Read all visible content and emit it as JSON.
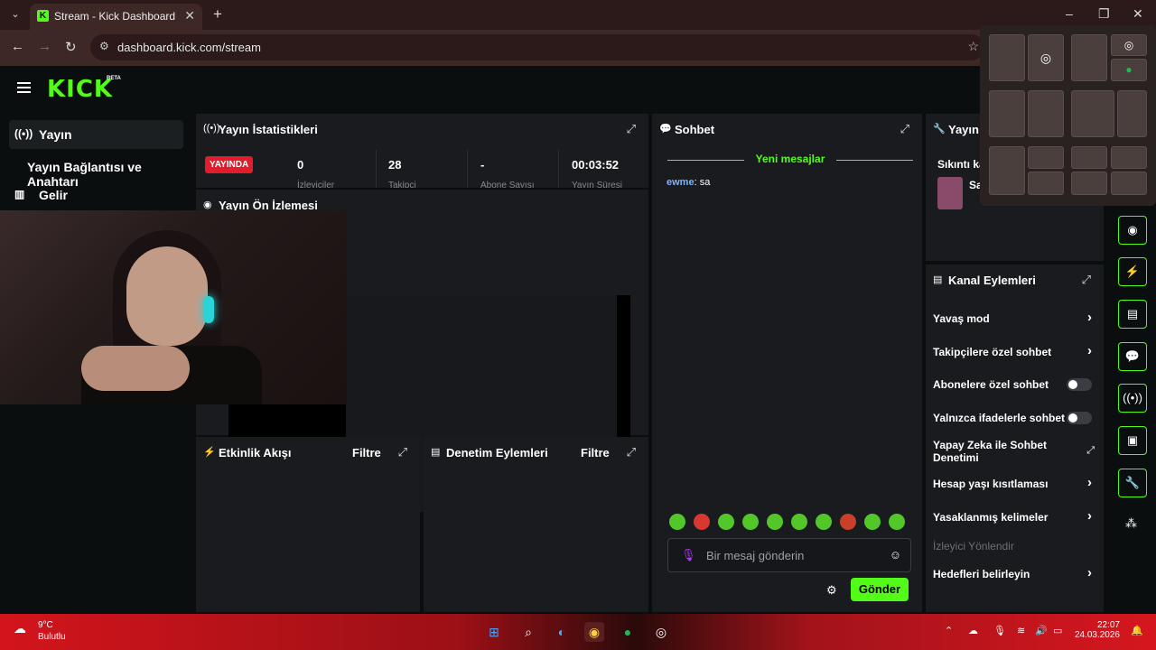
{
  "browser": {
    "tab_title": "Stream - Kick Dashboard",
    "url": "dashboard.kick.com/stream"
  },
  "header": {
    "logo": "KICK",
    "beta": "BETA"
  },
  "sidebar": {
    "items": [
      {
        "label": "Yayın",
        "icon": "broadcast-icon"
      },
      {
        "label": "Yayın Bağlantısı ve Anahtarı"
      },
      {
        "label": "Gelir",
        "icon": "chart-icon"
      }
    ]
  },
  "stats": {
    "title": "Yayın İstatistikleri",
    "live_badge": "YAYINDA",
    "values": [
      "0",
      "28",
      "-",
      "00:03:52"
    ],
    "labels": [
      "İzleyiciler",
      "Takipçi",
      "Abone Sayısı",
      "Yayın Süresi"
    ]
  },
  "preview": {
    "title": "Yayın Ön İzlemesi"
  },
  "activity": {
    "title": "Etkinlik Akışı",
    "filter": "Filtre"
  },
  "moderation": {
    "title": "Denetim Eylemleri",
    "filter": "Filtre"
  },
  "chat": {
    "title": "Sohbet",
    "new_messages": "Yeni mesajlar",
    "messages": [
      {
        "user": "ewme",
        "text": "sa"
      }
    ],
    "placeholder": "Bir mesaj gönderin",
    "send": "Gönder"
  },
  "stream_info": {
    "title": "Yayın",
    "partial": "Sıkıntı ka",
    "user_initial": "Sa"
  },
  "channel_actions": {
    "title": "Kanal Eylemleri",
    "rows": [
      {
        "label": "Yavaş mod",
        "control": "chevron"
      },
      {
        "label": "Takipçilere özel sohbet",
        "control": "chevron"
      },
      {
        "label": "Abonelere özel sohbet",
        "control": "toggle"
      },
      {
        "label": "Yalnızca ifadelerle sohbet",
        "control": "toggle"
      },
      {
        "label": "Yapay Zeka ile Sohbet Denetimi",
        "control": "external"
      },
      {
        "label": "Hesap yaşı kısıtlaması",
        "control": "chevron"
      },
      {
        "label": "Yasaklanmış kelimeler",
        "control": "chevron"
      },
      {
        "label": "İzleyici Yönlendir",
        "control": "none"
      },
      {
        "label": "Hedefleri belirleyin",
        "control": "chevron"
      }
    ]
  },
  "taskbar": {
    "temp": "9°C",
    "weather": "Bulutlu",
    "time": "22:07",
    "date": "24.03.2026"
  },
  "colors": {
    "accent": "#53fc18",
    "live": "#e11d2b",
    "panel": "#191b1f"
  }
}
